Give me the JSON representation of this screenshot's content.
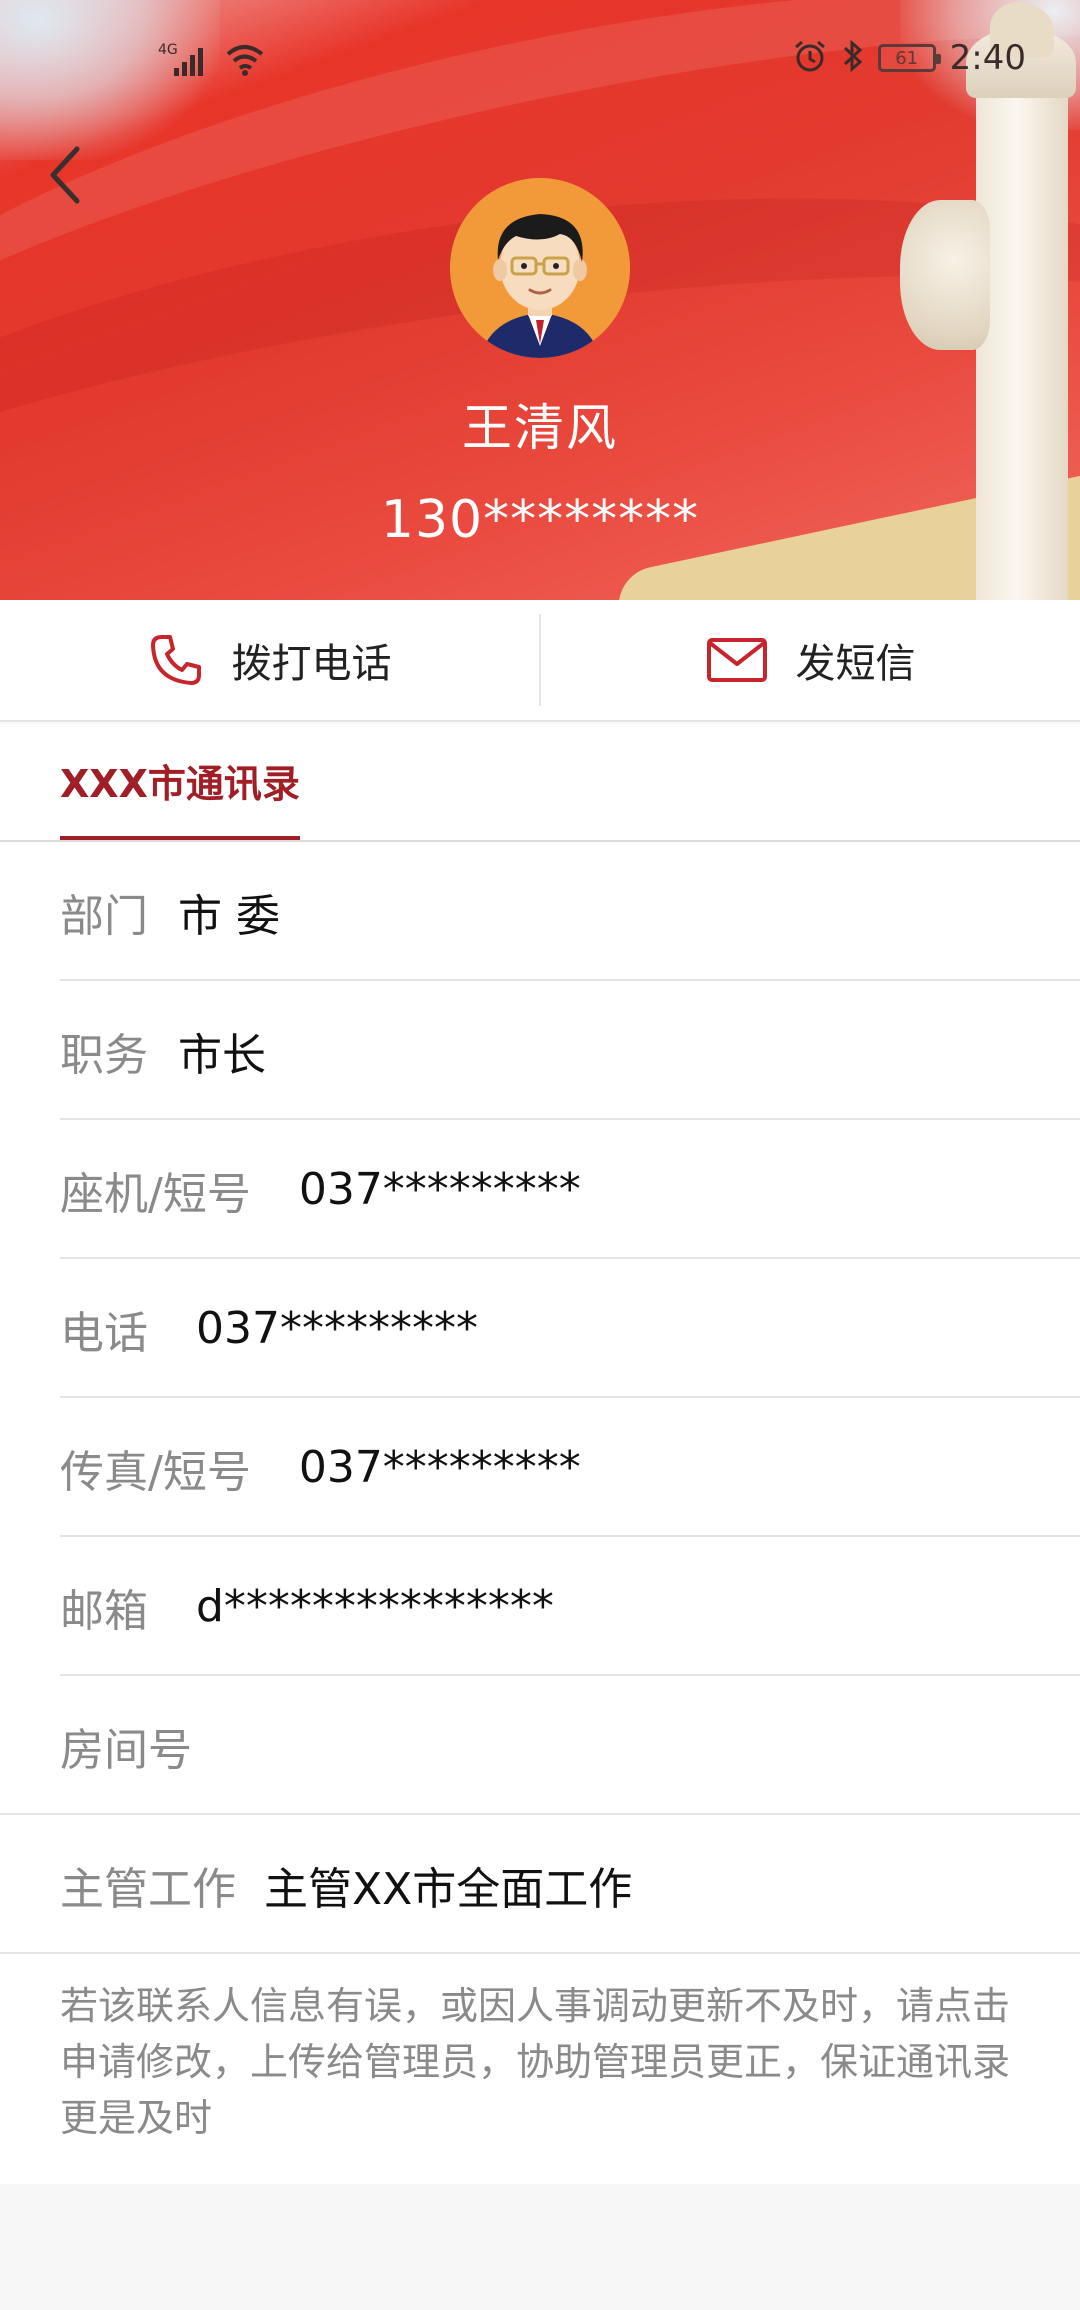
{
  "status_bar": {
    "network": "4G",
    "battery_level": "61",
    "time": "2:40"
  },
  "contact": {
    "name": "王清风",
    "phone": "130********"
  },
  "actions": {
    "call_label": "拨打电话",
    "sms_label": "发短信"
  },
  "tab": {
    "label": "XXX市通讯录"
  },
  "fields": [
    {
      "label": "部门",
      "value": "市 委"
    },
    {
      "label": "职务",
      "value": "市长"
    },
    {
      "label": "座机/短号",
      "value": "037*********"
    },
    {
      "label": "电话",
      "value": "037*********"
    },
    {
      "label": "传真/短号",
      "value": "037*********"
    },
    {
      "label": "邮箱",
      "value": "d***************"
    },
    {
      "label": "房间号",
      "value": ""
    },
    {
      "label": "主管工作",
      "value": "主管XX市全面工作"
    }
  ],
  "note": "若该联系人信息有误，或因人事调动更新不及时，请点击申请修改，上传给管理员，协助管理员更正，保证通讯录更是及时",
  "colors": {
    "accent": "#a01e25",
    "header_red": "#e23a2f",
    "icon_red": "#c8242c"
  },
  "icons": [
    "back-icon",
    "phone-icon",
    "mail-icon",
    "alarm-icon",
    "bluetooth-icon",
    "signal-icon",
    "wifi-icon"
  ]
}
